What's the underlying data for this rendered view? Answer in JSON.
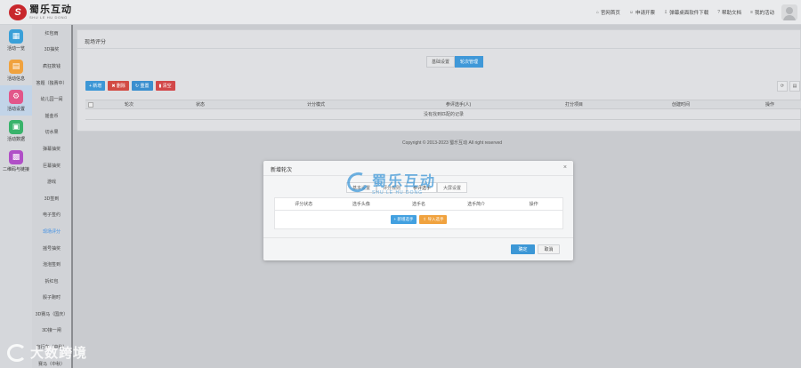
{
  "header": {
    "logo_mark": "S",
    "logo_cn": "蜀乐互动",
    "logo_en": "SHU LE HU DONG",
    "nav": [
      {
        "icon": "home-icon",
        "glyph": "⌂",
        "label": "官网首页"
      },
      {
        "icon": "user-icon",
        "glyph": "☺",
        "label": "申请开票"
      },
      {
        "icon": "download-icon",
        "glyph": "⇩",
        "label": "弹幕桌面软件下载"
      },
      {
        "icon": "help-icon",
        "glyph": "?",
        "label": "帮助文档"
      },
      {
        "icon": "list-icon",
        "glyph": "≡",
        "label": "我的活动"
      }
    ]
  },
  "rail": [
    {
      "label": "活动一览",
      "color": "#3aa0d8",
      "glyph": "▦",
      "icon": "grid-icon"
    },
    {
      "label": "活动信息",
      "color": "#f0a23e",
      "glyph": "▤",
      "icon": "info-icon"
    },
    {
      "label": "活动设置",
      "color": "#e2568a",
      "glyph": "⚙",
      "icon": "gear-icon",
      "active": true
    },
    {
      "label": "活动数据",
      "color": "#39b36b",
      "glyph": "▣",
      "icon": "data-icon"
    },
    {
      "label": "二维码与链接",
      "color": "#b04fc7",
      "glyph": "▩",
      "icon": "qrcode-icon"
    }
  ],
  "submenu": [
    "红包雨",
    "3D抽奖",
    "疯狂数钱",
    "答题（独赛中）",
    "幼儿园一闹",
    "摇金币",
    "切水果",
    "弹幕抽奖",
    "巨幕抽奖",
    "游戏",
    "3D签到",
    "电子签约",
    "现场评分",
    "摇号抽奖",
    "泡泡签到",
    "拆红包",
    "骰子跑时",
    "3D赛马（国庆）",
    "3D接一闸",
    "自行车（中秋）",
    "赛马（中秋）"
  ],
  "submenu_active": "现场评分",
  "panel": {
    "title": "现场评分",
    "tabs": [
      {
        "label": "基础设置",
        "active": false
      },
      {
        "label": "轮次管理",
        "active": true
      }
    ],
    "toolbar": [
      {
        "label": "+ 新增",
        "style": "blue",
        "name": "add-button"
      },
      {
        "label": "✖ 删除",
        "style": "red",
        "name": "delete-button"
      },
      {
        "label": "↻ 重置",
        "style": "blue2",
        "name": "reset-button"
      },
      {
        "label": "▮ 清空",
        "style": "red2",
        "name": "clear-button"
      }
    ],
    "tools_right": [
      "⟳",
      "▤"
    ],
    "columns": [
      "轮次",
      "状态",
      "计分模式",
      "参评选手(人)",
      "打分项目",
      "创建时间",
      "操作"
    ],
    "empty_text": "没有找到匹配的记录"
  },
  "copyright": "Copyright © 2013-2023 蜀乐互动 All right reserved",
  "modal": {
    "title": "新增轮次",
    "close": "×",
    "tabs": [
      {
        "label": "基本设置",
        "active": false
      },
      {
        "label": "评分规则",
        "active": false
      },
      {
        "label": "参评选手",
        "active": true
      },
      {
        "label": "大屏设置",
        "active": false
      }
    ],
    "columns": [
      "评分状态",
      "选手头像",
      "选手名",
      "选手简介",
      "操作"
    ],
    "add_player": "+ 新增选手",
    "import_player": "⇪ 导入选手",
    "ok": "确定",
    "cancel": "取消"
  },
  "watermark": {
    "center_cn": "蜀乐互动",
    "center_en": "SHU LE HU DONG",
    "bottom": "大数跨境"
  }
}
